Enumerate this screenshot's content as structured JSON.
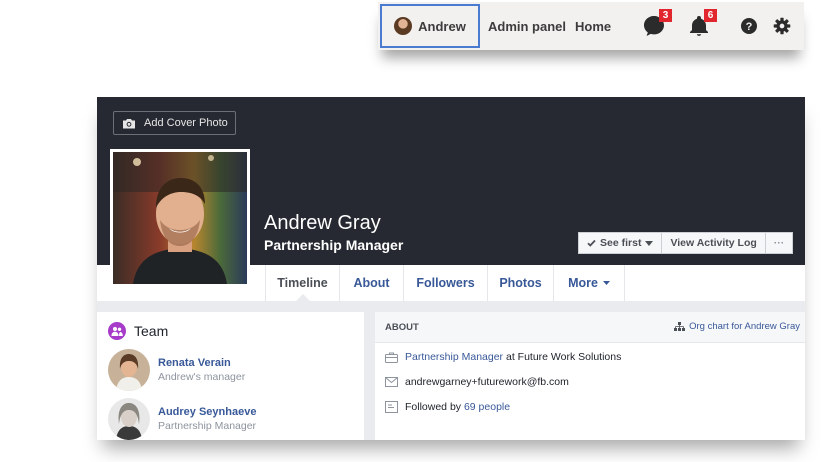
{
  "topnav": {
    "user": "Andrew",
    "admin_panel": "Admin panel",
    "home": "Home",
    "messages_count": "3",
    "notifications_count": "6"
  },
  "profile": {
    "add_cover_photo": "Add Cover Photo",
    "name": "Andrew Gray",
    "job_title": "Partnership Manager",
    "see_first": "See first",
    "view_activity_log": "View Activity Log",
    "more_dots": "···"
  },
  "tabs": [
    {
      "label": "Timeline"
    },
    {
      "label": "About"
    },
    {
      "label": "Followers"
    },
    {
      "label": "Photos"
    },
    {
      "label": "More"
    }
  ],
  "team": {
    "title": "Team",
    "members": [
      {
        "name": "Renata Verain",
        "role": "Andrew's manager"
      },
      {
        "name": "Audrey Seynhaeve",
        "role": "Partnership Manager"
      }
    ]
  },
  "about": {
    "title": "ABOUT",
    "org_chart_link": "Org chart for Andrew Gray",
    "work_role": "Partnership Manager",
    "work_company": "at Future Work Solutions",
    "email": "andrewgarney+futurework@fb.com",
    "followed_prefix": "Followed by",
    "followed_link": "69 people"
  },
  "colors": {
    "cover_bg": "#262931",
    "link_blue": "#385898",
    "badge_red": "#e1262d",
    "team_icon_purple": "#a63cc9"
  }
}
